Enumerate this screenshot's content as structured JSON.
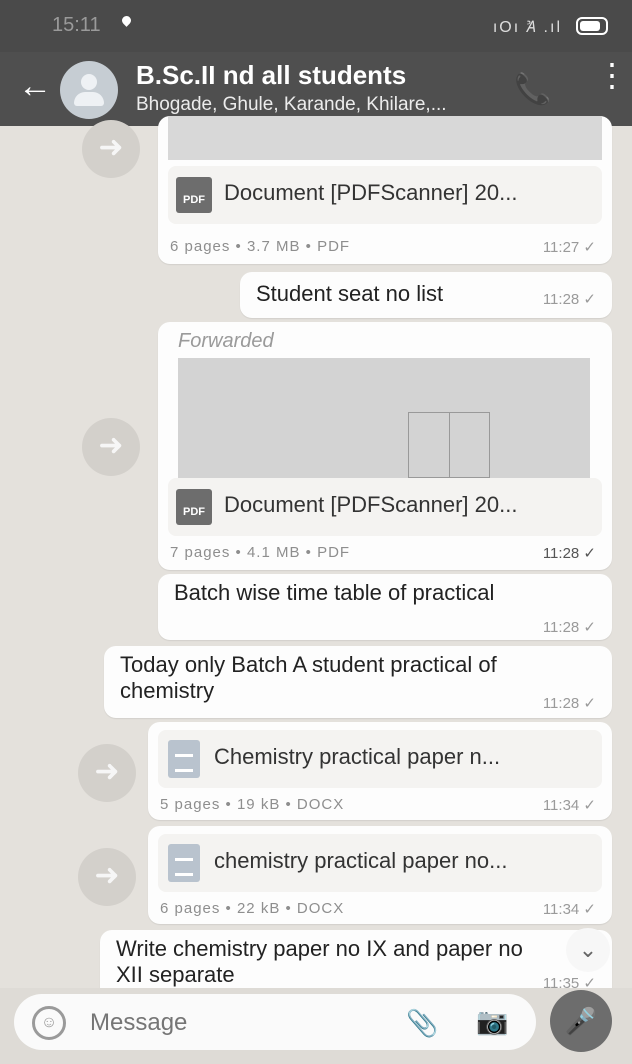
{
  "status": {
    "time": "15:11",
    "icons": "ıOı Ꞻ .ıl"
  },
  "header": {
    "title": "B.Sc.II nd all students",
    "subtitle": "Bhogade, Ghule, Karande, Khilare,...",
    "back_icon": "←",
    "call_icon": "📞",
    "menu_icon": "⋮"
  },
  "messages": [
    {
      "kind": "doc",
      "name": "Document [PDFScanner] 20...",
      "meta": "6 pages • 3.7 MB • PDF",
      "time": "11:27 ✓"
    },
    {
      "kind": "text",
      "text": "Student seat no list",
      "time": "11:28 ✓"
    },
    {
      "kind": "doc",
      "forwarded": "Forwarded",
      "name": "Document [PDFScanner] 20...",
      "meta": "7 pages • 4.1 MB • PDF",
      "time": "11:28 ✓"
    },
    {
      "kind": "text",
      "text": "Batch wise time table of practical",
      "time": "11:28 ✓"
    },
    {
      "kind": "text",
      "text": "Today only Batch A student practical of chemistry",
      "time": "11:28 ✓"
    },
    {
      "kind": "doc",
      "name": "Chemistry practical paper n...",
      "meta": "5 pages • 19 kB • DOCX",
      "time": "11:34 ✓"
    },
    {
      "kind": "doc",
      "name": "chemistry practical paper no...",
      "meta": "6 pages • 22 kB • DOCX",
      "time": "11:34 ✓"
    },
    {
      "kind": "text",
      "text": "Write chemistry paper no IX and paper no XII separate",
      "time": "11:35 ✓"
    }
  ],
  "composer": {
    "placeholder": "Message"
  }
}
